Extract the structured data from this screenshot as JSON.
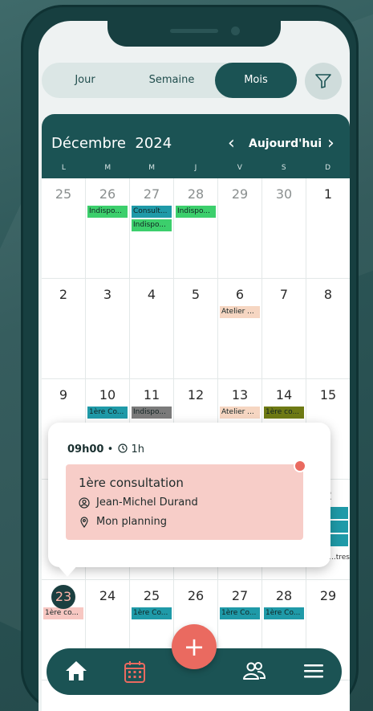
{
  "view_switch": {
    "items": [
      "Jour",
      "Semaine",
      "Mois"
    ],
    "active": "Mois"
  },
  "calendar": {
    "month": "Décembre",
    "year": "2024",
    "today_label": "Aujourd'hui",
    "weekdays": [
      "L",
      "M",
      "M",
      "J",
      "V",
      "S",
      "D"
    ],
    "weeks": [
      {
        "days": [
          {
            "num": "25",
            "events": []
          },
          {
            "num": "26",
            "events": [
              {
                "text": "Indispo...",
                "color": "green"
              }
            ]
          },
          {
            "num": "27",
            "events": [
              {
                "text": "Consult...",
                "color": "teal"
              },
              {
                "text": "Indispo...",
                "color": "green"
              }
            ]
          },
          {
            "num": "28",
            "events": [
              {
                "text": "Indispo...",
                "color": "green"
              }
            ]
          },
          {
            "num": "29",
            "events": []
          },
          {
            "num": "30",
            "events": []
          },
          {
            "num": "1",
            "events": []
          }
        ]
      },
      {
        "days": [
          {
            "num": "2",
            "events": []
          },
          {
            "num": "3",
            "events": []
          },
          {
            "num": "4",
            "events": []
          },
          {
            "num": "5",
            "events": []
          },
          {
            "num": "6",
            "events": [
              {
                "text": "Atelier ...",
                "color": "peach"
              }
            ]
          },
          {
            "num": "7",
            "events": []
          },
          {
            "num": "8",
            "events": []
          }
        ]
      },
      {
        "days": [
          {
            "num": "9",
            "events": []
          },
          {
            "num": "10",
            "events": [
              {
                "text": "1ère Co...",
                "color": "teal"
              }
            ]
          },
          {
            "num": "11",
            "events": [
              {
                "text": "Indispo...",
                "color": "gray"
              }
            ]
          },
          {
            "num": "12",
            "events": []
          },
          {
            "num": "13",
            "events": [
              {
                "text": "Atelier ...",
                "color": "peach"
              }
            ]
          },
          {
            "num": "14",
            "events": [
              {
                "text": "1ère co...",
                "color": "olive"
              }
            ]
          },
          {
            "num": "15",
            "events": []
          }
        ]
      },
      {
        "days": [
          {
            "num": "",
            "events": []
          },
          {
            "num": "",
            "events": []
          },
          {
            "num": "",
            "events": []
          },
          {
            "num": "",
            "events": []
          },
          {
            "num": "",
            "events": []
          },
          {
            "num": "",
            "events": []
          },
          {
            "num": "2",
            "events": [
              {
                "text": "Co...",
                "color": "teal"
              },
              {
                "text": "Co...",
                "color": "teal"
              },
              {
                "text": "Co...",
                "color": "teal"
              }
            ],
            "more": "...tres"
          }
        ]
      },
      {
        "days": [
          {
            "num": "23",
            "today": true,
            "events": [
              {
                "text": "1ère co...",
                "color": "pink"
              }
            ]
          },
          {
            "num": "24",
            "events": []
          },
          {
            "num": "25",
            "events": [
              {
                "text": "1ère Co...",
                "color": "teal"
              }
            ]
          },
          {
            "num": "26",
            "events": []
          },
          {
            "num": "27",
            "events": [
              {
                "text": "1ère Co...",
                "color": "teal"
              }
            ]
          },
          {
            "num": "28",
            "events": [
              {
                "text": "1ère Co...",
                "color": "teal"
              }
            ]
          },
          {
            "num": "29",
            "events": []
          }
        ]
      }
    ]
  },
  "popup": {
    "time": "09h00",
    "separator": "•",
    "duration": "1h",
    "title": "1ère consultation",
    "client": "Jean-Michel Durand",
    "planning": "Mon planning"
  },
  "bottom_nav": {
    "items": [
      "home-icon",
      "calendar-icon",
      "users-icon",
      "menu-icon"
    ],
    "fab": "+"
  },
  "colors": {
    "primary": "#1b5354",
    "accent": "#ea6a60",
    "green": "#3ccf6c",
    "teal": "#1f9aa8",
    "peach": "#f6d6c2",
    "gray": "#7b7b7b",
    "olive": "#6e7a14",
    "pink": "#f7c7c2"
  }
}
